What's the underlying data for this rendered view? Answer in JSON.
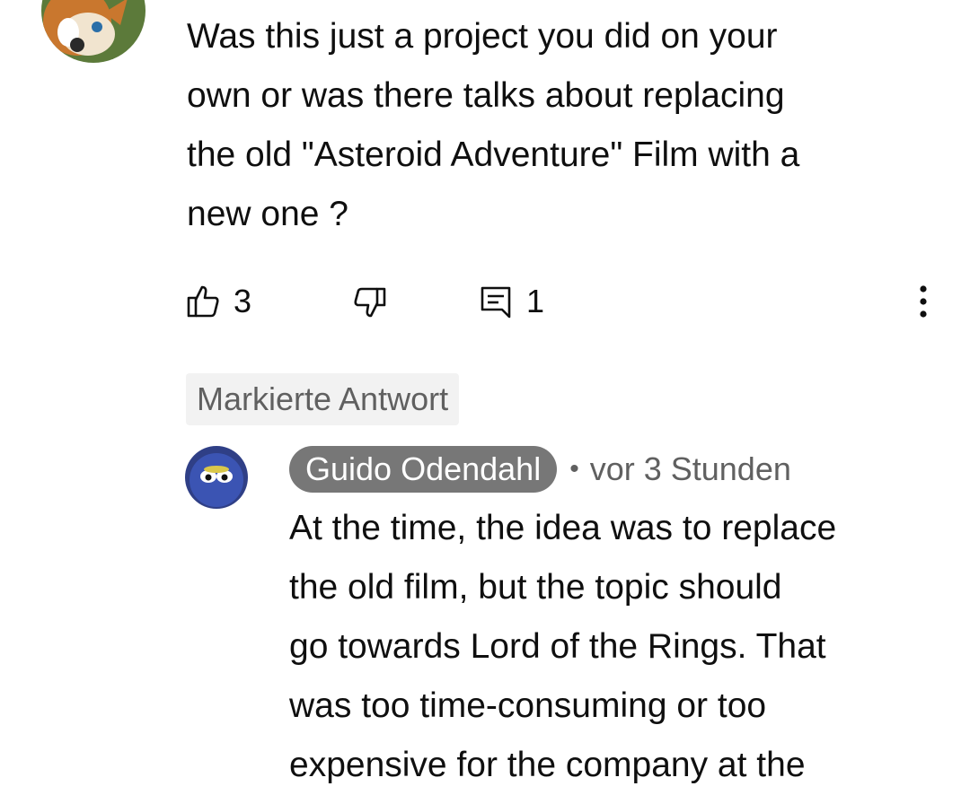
{
  "comment": {
    "text": "Was this just a project you did on your\nown or was there talks about replacing\nthe old \"Asteroid Adventure\" Film with a\nnew one ?",
    "like_count": "3",
    "reply_count": "1",
    "icons": {
      "like": "thumbs-up-icon",
      "dislike": "thumbs-down-icon",
      "reply": "comment-reply-icon",
      "more": "more-vertical-icon"
    }
  },
  "badge": {
    "label": "Markierte Antwort"
  },
  "reply": {
    "author": "Guido Odendahl",
    "separator": "•",
    "time": "vor 3 Stunden",
    "text": "At the time, the idea was to replace\nthe old film, but the topic should\ngo towards Lord of the Rings. That\nwas too time-consuming or too\nexpensive for the company at the"
  },
  "colors": {
    "text": "#0f0f0f",
    "secondary": "#606060",
    "author_chip": "#777777",
    "badge_bg": "#f2f2f2"
  }
}
